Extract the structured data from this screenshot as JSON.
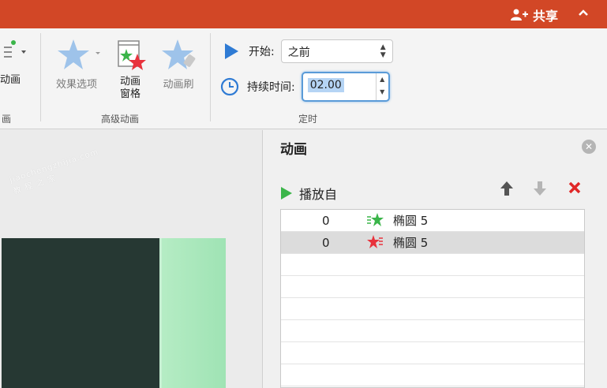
{
  "titlebar": {
    "share_label": "共享",
    "share_icon": "add-person-icon",
    "collapse_icon": "chevron-up-icon",
    "color": "#d24726"
  },
  "ribbon": {
    "anim_label": "动画",
    "effect_options_label": "效果选项",
    "anim_pane_label_1": "动画",
    "anim_pane_label_2": "窗格",
    "anim_painter_label": "动画刷",
    "group_anim": "画",
    "group_advanced": "高级动画",
    "group_timing": "定时",
    "start_label": "开始:",
    "start_value": "之前",
    "duration_label": "持续时间:",
    "duration_value": "02.00"
  },
  "pane": {
    "title": "动画",
    "play_from_label": "播放自",
    "items": [
      {
        "order": "0",
        "name": "椭圆 5",
        "effect": "entrance",
        "icon": "entrance-star-icon",
        "selected": false
      },
      {
        "order": "0",
        "name": "椭圆 5",
        "effect": "exit",
        "icon": "exit-star-icon",
        "selected": true
      }
    ]
  },
  "watermark": "jiaochengzhijia.com 教程之家"
}
